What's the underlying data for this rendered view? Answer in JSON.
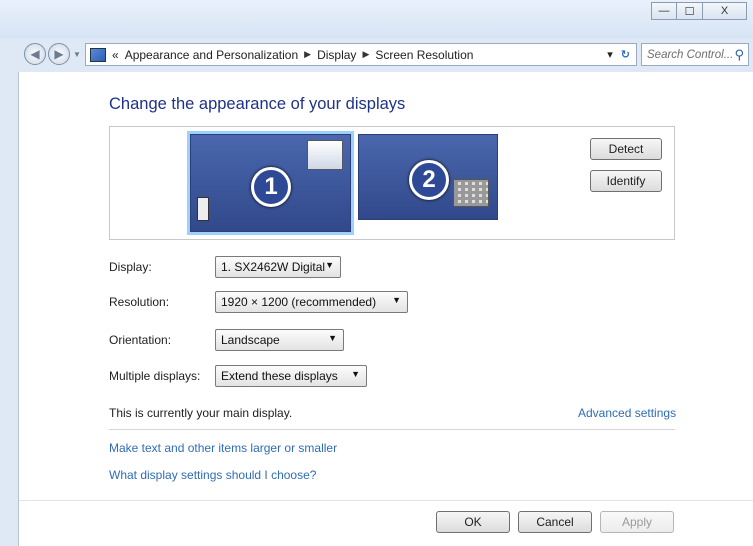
{
  "window": {
    "minimize_glyph": "—",
    "maximize_glyph": "☐",
    "close_glyph": "X"
  },
  "address": {
    "overflow": "«",
    "crumbs": [
      "Appearance and Personalization",
      "Display",
      "Screen Resolution"
    ],
    "separator": "▶",
    "dropdown_glyph": "▾",
    "refresh_glyph": "↻",
    "search_placeholder": "Search Control..."
  },
  "page": {
    "heading": "Change the appearance of your displays"
  },
  "monitors": [
    {
      "number": "1"
    },
    {
      "number": "2"
    }
  ],
  "buttons": {
    "detect": "Detect",
    "identify": "Identify",
    "ok": "OK",
    "cancel": "Cancel",
    "apply": "Apply"
  },
  "settings": {
    "display_label": "Display:",
    "display_value": "1. SX2462W Digital",
    "resolution_label": "Resolution:",
    "resolution_value": "1920 × 1200 (recommended)",
    "orientation_label": "Orientation:",
    "orientation_value": "Landscape",
    "multiple_label": "Multiple displays:",
    "multiple_value": "Extend these displays",
    "arrow": "▼"
  },
  "notes": {
    "main_display": "This is currently your main display.",
    "advanced": "Advanced settings",
    "link_text_size": "Make text and other items larger or smaller",
    "link_help": "What display settings should I choose?"
  },
  "colors": {
    "link": "#2f6db5",
    "heading": "#1e3287",
    "monitor": "#3f5aa0"
  }
}
